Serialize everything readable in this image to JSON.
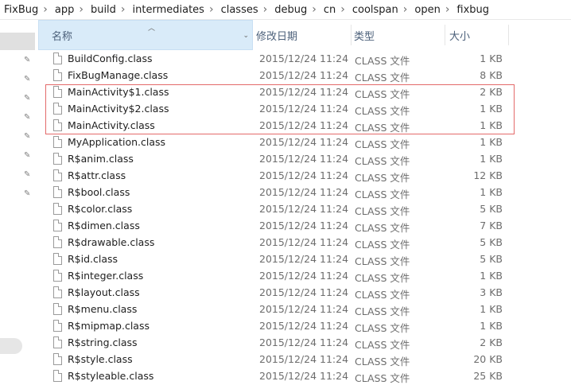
{
  "breadcrumb": [
    "FixBug",
    "app",
    "build",
    "intermediates",
    "classes",
    "debug",
    "cn",
    "coolspan",
    "open",
    "fixbug"
  ],
  "columns": {
    "name": "名称",
    "date": "修改日期",
    "type": "类型",
    "size": "大小"
  },
  "files": [
    {
      "name": "BuildConfig.class",
      "date": "2015/12/24 11:24",
      "type": "CLASS 文件",
      "size": "1 KB"
    },
    {
      "name": "FixBugManage.class",
      "date": "2015/12/24 11:24",
      "type": "CLASS 文件",
      "size": "8 KB"
    },
    {
      "name": "MainActivity$1.class",
      "date": "2015/12/24 11:24",
      "type": "CLASS 文件",
      "size": "2 KB"
    },
    {
      "name": "MainActivity$2.class",
      "date": "2015/12/24 11:24",
      "type": "CLASS 文件",
      "size": "1 KB"
    },
    {
      "name": "MainActivity.class",
      "date": "2015/12/24 11:24",
      "type": "CLASS 文件",
      "size": "1 KB"
    },
    {
      "name": "MyApplication.class",
      "date": "2015/12/24 11:24",
      "type": "CLASS 文件",
      "size": "1 KB"
    },
    {
      "name": "R$anim.class",
      "date": "2015/12/24 11:24",
      "type": "CLASS 文件",
      "size": "1 KB"
    },
    {
      "name": "R$attr.class",
      "date": "2015/12/24 11:24",
      "type": "CLASS 文件",
      "size": "12 KB"
    },
    {
      "name": "R$bool.class",
      "date": "2015/12/24 11:24",
      "type": "CLASS 文件",
      "size": "1 KB"
    },
    {
      "name": "R$color.class",
      "date": "2015/12/24 11:24",
      "type": "CLASS 文件",
      "size": "5 KB"
    },
    {
      "name": "R$dimen.class",
      "date": "2015/12/24 11:24",
      "type": "CLASS 文件",
      "size": "7 KB"
    },
    {
      "name": "R$drawable.class",
      "date": "2015/12/24 11:24",
      "type": "CLASS 文件",
      "size": "5 KB"
    },
    {
      "name": "R$id.class",
      "date": "2015/12/24 11:24",
      "type": "CLASS 文件",
      "size": "5 KB"
    },
    {
      "name": "R$integer.class",
      "date": "2015/12/24 11:24",
      "type": "CLASS 文件",
      "size": "1 KB"
    },
    {
      "name": "R$layout.class",
      "date": "2015/12/24 11:24",
      "type": "CLASS 文件",
      "size": "3 KB"
    },
    {
      "name": "R$menu.class",
      "date": "2015/12/24 11:24",
      "type": "CLASS 文件",
      "size": "1 KB"
    },
    {
      "name": "R$mipmap.class",
      "date": "2015/12/24 11:24",
      "type": "CLASS 文件",
      "size": "1 KB"
    },
    {
      "name": "R$string.class",
      "date": "2015/12/24 11:24",
      "type": "CLASS 文件",
      "size": "2 KB"
    },
    {
      "name": "R$style.class",
      "date": "2015/12/24 11:24",
      "type": "CLASS 文件",
      "size": "20 KB"
    },
    {
      "name": "R$styleable.class",
      "date": "2015/12/24 11:24",
      "type": "CLASS 文件",
      "size": "25 KB"
    }
  ],
  "icons": {
    "pin": "pin-icon",
    "file": "file-icon",
    "sort": "sort-up-icon",
    "chevron": "chevron-down-icon"
  },
  "colors": {
    "header_selected": "#d9ebf9",
    "highlight_border": "#e36a6a"
  }
}
